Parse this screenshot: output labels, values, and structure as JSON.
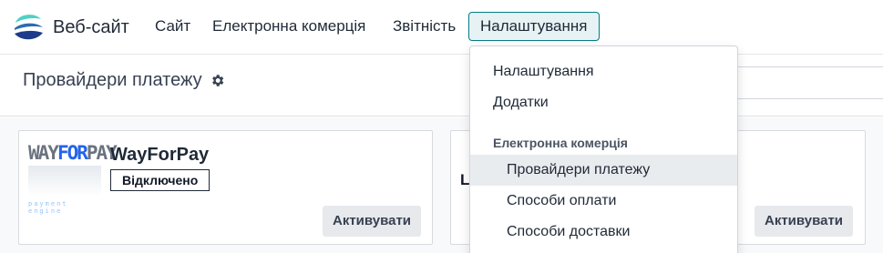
{
  "navbar": {
    "app_name": "Веб-сайт",
    "menu": [
      {
        "label": "Сайт"
      },
      {
        "label": "Електронна комерція"
      },
      {
        "label": "Звітність"
      },
      {
        "label": "Налаштування"
      }
    ]
  },
  "control_panel": {
    "title": "Провайдери платежу"
  },
  "cards": [
    {
      "name": "WayForPay",
      "logo_text": {
        "left": "WAY",
        "mid": "FOR",
        "right": "PAY",
        "sub": "payment engine"
      },
      "state": "Відключено",
      "action_label": "Активувати"
    },
    {
      "visible_text": "L",
      "action_label": "Активувати"
    }
  ],
  "dropdown": {
    "items": [
      {
        "label": "Налаштування"
      },
      {
        "label": "Додатки"
      }
    ],
    "section_header": "Електронна комерція",
    "section_items": [
      {
        "label": "Провайдери платежу"
      },
      {
        "label": "Способи оплати"
      },
      {
        "label": "Способи доставки"
      }
    ]
  },
  "colors": {
    "accent": "#017e84",
    "active_menu_bg": "#e6f2f3",
    "hover_bg": "#e9ecef",
    "button_bg": "#e7e9ed"
  }
}
